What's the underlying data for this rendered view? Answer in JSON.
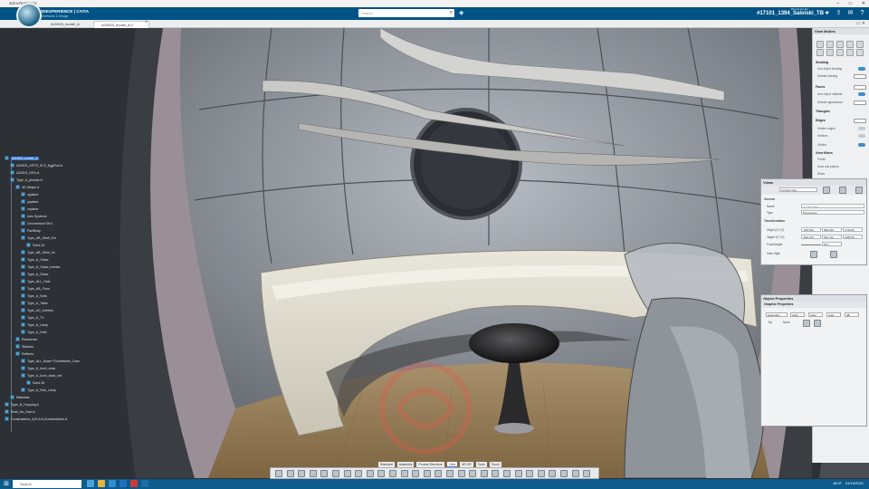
{
  "window": {
    "title": "3DEXPERIENCE"
  },
  "appbar": {
    "brand": "3DEXPERIENCE | CATIA",
    "subtitle": "Wireframe & Design",
    "search_placeholder": "Search",
    "user": "#17101_1394_Saloiski_TB ▾",
    "user_top": "Bla bla bla bla",
    "icons": [
      "tag-icon",
      "share-icon",
      "add-icon",
      "communication-icon",
      "help-icon"
    ]
  },
  "tabs": [
    "A20303_model_A",
    "A20303_model_A.2"
  ],
  "tab_controls": "▭ ✕",
  "tree": {
    "items": [
      {
        "label": "A20303_model_A",
        "indent": 0,
        "sel": true
      },
      {
        "label": "A20303_ARTS_SLS_EggPod-A",
        "indent": 1
      },
      {
        "label": "A20303_DRV-A",
        "indent": 1
      },
      {
        "label": "Type_A_pinnkle A",
        "indent": 1
      },
      {
        "label": "3D Shape A",
        "indent": 2
      },
      {
        "label": "xyplane",
        "indent": 3
      },
      {
        "label": "yzplane",
        "indent": 3
      },
      {
        "label": "zxplane",
        "indent": 3
      },
      {
        "label": "Axis Systems",
        "indent": 3
      },
      {
        "label": "Geometrical Set.1",
        "indent": 3
      },
      {
        "label": "PartBody",
        "indent": 3
      },
      {
        "label": "Type_AB_Shell_Ext",
        "indent": 3
      },
      {
        "label": "Solid.15",
        "indent": 4
      },
      {
        "label": "Type_AB_Shell_Int",
        "indent": 3
      },
      {
        "label": "Type_A_Glass",
        "indent": 3
      },
      {
        "label": "Type_A_Glass_frames",
        "indent": 3
      },
      {
        "label": "Type_A_Glass",
        "indent": 3
      },
      {
        "label": "Type_ALL_Hide",
        "indent": 3
      },
      {
        "label": "Type_AB_Floor",
        "indent": 3
      },
      {
        "label": "Type_A_Sofa",
        "indent": 3
      },
      {
        "label": "Type_A_Table",
        "indent": 3
      },
      {
        "label": "Type_AC_shelves",
        "indent": 3
      },
      {
        "label": "Type_A_TV",
        "indent": 3
      },
      {
        "label": "Type_A_Lamp",
        "indent": 3
      },
      {
        "label": "Type_A_Hole",
        "indent": 3
      },
      {
        "label": "Resources",
        "indent": 2
      },
      {
        "label": "Statsins",
        "indent": 2
      },
      {
        "label": "Reflcms",
        "indent": 2
      },
      {
        "label": "Type_ALL_Base+Thumbfeets_Cons",
        "indent": 3
      },
      {
        "label": "Type_A_Arch_chair",
        "indent": 3
      },
      {
        "label": "Type_A_Arch_chair_mtl",
        "indent": 3
      },
      {
        "label": "Solid.18",
        "indent": 4
      },
      {
        "label": "Type_A_Stdr_Lamp",
        "indent": 3
      },
      {
        "label": "Materials",
        "indent": 1
      },
      {
        "label": "Type_B_Hopping A",
        "indent": 0
      },
      {
        "label": "Shell_for_Hain A",
        "indent": 0
      },
      {
        "label": "Constraintms_A20 A A (Constraintms A",
        "indent": 0
      }
    ]
  },
  "view_modes": {
    "title": "View Modes",
    "shading": "Shading",
    "use_obj_shading": "Use object shading",
    "default_shading": "Default shading",
    "faces": "Faces",
    "use_obj_material": "Use object material",
    "default_appearance": "Default appearance",
    "triangles": "Triangles",
    "edges": "Edges",
    "hidden_edges": "Hidden edges",
    "vertices": "Vertices",
    "outline": "Outline",
    "view_filters": "View filters",
    "points": "Points",
    "axes_planes": "Axes and planes",
    "wires": "Wires"
  },
  "views": {
    "title": "Views",
    "dropdown": "Current View",
    "general": "General",
    "name_label": "Name",
    "name_value": "Current View",
    "type_label": "Type",
    "type_value": "Perspective",
    "transformation": "Transformation",
    "origin_label": "Origin (X,Y,Z)",
    "origin": [
      "-948.634",
      "689.919",
      "1748.66"
    ],
    "target_label": "Target (X,Y,Z)",
    "target": [
      "-649.270",
      "664.712",
      "1680.50"
    ],
    "focal_label": "Focal length",
    "focal_value": "56.2",
    "view_style_label": "View Style"
  },
  "object_properties": {
    "title": "Object Properties",
    "graphic_properties": "Graphic Properties",
    "dropdowns": [
      "Automatic",
      "Autm",
      "Autm",
      "Auto",
      "dflt"
    ],
    "none_label": "None",
    "row2": [
      "No",
      "None",
      "·"
    ]
  },
  "section_tabs": [
    "Standard",
    "Assembly",
    "Product Structure",
    "View",
    "AR-VR",
    "Tools",
    "Touch"
  ],
  "taskbar": {
    "search": "Search",
    "time": "18:57",
    "date": "01/10/2021"
  }
}
